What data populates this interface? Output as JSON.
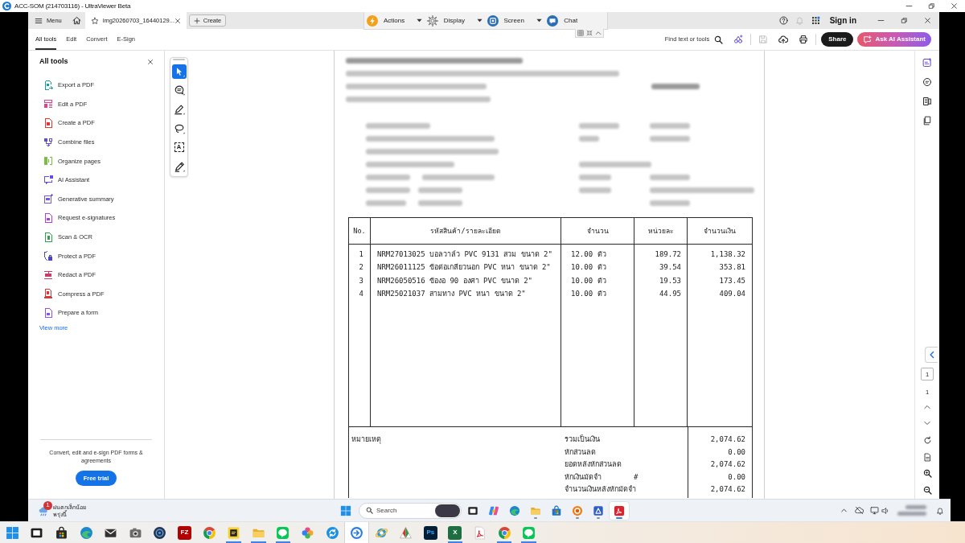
{
  "viewer_window": {
    "title": "ACC-SOM (214703116) - UltraViewer Beta"
  },
  "app_tabbar": {
    "menu_label": "Menu",
    "document_tab": {
      "label": "img20260703_16440129...",
      "selected": true
    },
    "create_label": "Create",
    "sign_in_label": "Sign in"
  },
  "viewer_toolbar": [
    {
      "kind": "actions",
      "label": "Actions",
      "dropdown": true
    },
    {
      "kind": "display",
      "label": "Display",
      "dropdown": true
    },
    {
      "kind": "screen",
      "label": "Screen",
      "dropdown": true
    },
    {
      "kind": "chat",
      "label": "Chat",
      "dropdown": false
    }
  ],
  "app_toolbar": {
    "tabs": [
      {
        "label": "All tools",
        "selected": true
      },
      {
        "label": "Edit",
        "selected": false
      },
      {
        "label": "Convert",
        "selected": false
      },
      {
        "label": "E-Sign",
        "selected": false
      }
    ],
    "find_label": "Find text or tools",
    "actions": [
      {
        "kind": "ai_tools",
        "disabled": false
      },
      {
        "kind": "save",
        "disabled": true
      },
      {
        "kind": "upload",
        "disabled": false
      },
      {
        "kind": "print",
        "disabled": false
      }
    ],
    "share_label": "Share",
    "ai_label": "Ask AI Assistant"
  },
  "tools_panel": {
    "title": "All tools",
    "items": [
      {
        "kind": "export",
        "label": "Export a PDF",
        "color": "#1d9a9f"
      },
      {
        "kind": "edit",
        "label": "Edit a PDF",
        "color": "#e0408c"
      },
      {
        "kind": "create",
        "label": "Create a PDF",
        "color": "#d83a3a"
      },
      {
        "kind": "combine",
        "label": "Combine files",
        "color": "#5a4fd4"
      },
      {
        "kind": "organize",
        "label": "Organize pages",
        "color": "#7cbf3f"
      },
      {
        "kind": "ai",
        "label": "AI Assistant",
        "color": "#6b48ee"
      },
      {
        "kind": "summary",
        "label": "Generative summary",
        "color": "#7756ef"
      },
      {
        "kind": "request_sign",
        "label": "Request e-signatures",
        "color": "#b13fcf"
      },
      {
        "kind": "scan",
        "label": "Scan & OCR",
        "color": "#34a04b"
      },
      {
        "kind": "protect",
        "label": "Protect a PDF",
        "color": "#4b46c7"
      },
      {
        "kind": "redact",
        "label": "Redact a PDF",
        "color": "#c83b6b"
      },
      {
        "kind": "compress",
        "label": "Compress a PDF",
        "color": "#d63b3b"
      },
      {
        "kind": "form",
        "label": "Prepare a form",
        "color": "#8957d8"
      }
    ],
    "more_link": "View more",
    "promo_text": "Convert, edit and e-sign PDF forms & agreements",
    "trial_button": "Free trial"
  },
  "quick_tools": [
    {
      "kind": "select",
      "selected": true
    },
    {
      "kind": "comment",
      "selected": false
    },
    {
      "kind": "draw",
      "selected": false
    },
    {
      "kind": "lasso",
      "selected": false
    },
    {
      "kind": "text_select",
      "glyph": "A",
      "selected": false
    },
    {
      "kind": "sign",
      "selected": false
    }
  ],
  "document": {
    "table": {
      "columns": [
        "No.",
        "รหัสสินค้า/รายละเอียด",
        "จำนวน",
        "หน่วยละ",
        "จำนวนเงิน"
      ],
      "rows": [
        {
          "no": "1",
          "item": "NRM27013025 บอลวาล์ว PVC 9131 สวม ขนาด 2\"",
          "quantity": "12.00 ตัว",
          "unit_price": "189.72",
          "amount": "1,138.32"
        },
        {
          "no": "2",
          "item": "NRM26011125 ข้อต่อเกลียวนอก PVC หนา ขนาด 2\"",
          "quantity": "10.00 ตัว",
          "unit_price": "39.54",
          "amount": "353.81"
        },
        {
          "no": "3",
          "item": "NRM26050516 ข้องอ 90 องศา PVC ขนาด 2\"",
          "quantity": "10.00 ตัว",
          "unit_price": "19.53",
          "amount": "173.45"
        },
        {
          "no": "4",
          "item": "NRM25021037 สามทาง PVC หนา ขนาด 2\"",
          "quantity": "10.00 ตัว",
          "unit_price": "44.95",
          "amount": "409.04"
        }
      ]
    },
    "summary": {
      "note_label": "หมายเหตุ",
      "lines": [
        {
          "label": "รวมเป็นเงิน",
          "value": "2,074.62"
        },
        {
          "label": "หักส่วนลด",
          "value": "0.00"
        },
        {
          "label": "ยอดหลังหักส่วนลด",
          "value": "2,074.62"
        },
        {
          "label": "หักเงินมัดจำ",
          "mark": "#",
          "value": "0.00"
        },
        {
          "label": "จำนวนเงินหลังหักมัดจำ",
          "value": "2,074.62"
        }
      ]
    }
  },
  "page_nav": {
    "current_page": "1",
    "page_count": "1"
  },
  "remote_taskbar": {
    "weather": {
      "badge": "1",
      "lines": [
        "ฝนตกเล็กน้อย",
        "พรุ่งนี้"
      ]
    },
    "search": {
      "placeholder": "Search"
    },
    "apps": [
      {
        "kind": "task_view",
        "running": false,
        "selected": false
      },
      {
        "kind": "copilot",
        "running": false,
        "selected": false
      },
      {
        "kind": "edge",
        "running": false,
        "selected": false
      },
      {
        "kind": "explorer",
        "running": true,
        "selected": false
      },
      {
        "kind": "store",
        "running": false,
        "selected": false
      },
      {
        "kind": "disc",
        "running": true,
        "selected": false
      },
      {
        "kind": "triangle_tile",
        "running": true,
        "selected": false
      },
      {
        "kind": "acrobat",
        "running": true,
        "selected": true
      }
    ]
  },
  "local_taskbar": {
    "apps": [
      {
        "kind": "start",
        "running": false,
        "selected": false
      },
      {
        "kind": "task_view",
        "running": false,
        "selected": false
      },
      {
        "kind": "store",
        "running": false,
        "selected": false
      },
      {
        "kind": "edge",
        "running": false,
        "selected": false
      },
      {
        "kind": "mail",
        "running": false,
        "selected": false
      },
      {
        "kind": "camera",
        "running": false,
        "selected": false
      },
      {
        "kind": "disc",
        "running": false,
        "selected": false
      },
      {
        "kind": "filezilla",
        "glyph": "FZ",
        "running": false,
        "selected": false
      },
      {
        "kind": "chrome",
        "running": false,
        "selected": false
      },
      {
        "kind": "sticky",
        "running": true,
        "selected": false
      },
      {
        "kind": "explorer",
        "running": true,
        "selected": false
      },
      {
        "kind": "line",
        "running": true,
        "selected": false
      },
      {
        "kind": "petals",
        "running": false,
        "selected": false
      },
      {
        "kind": "sync",
        "running": false,
        "selected": false
      },
      {
        "kind": "arrow_disc",
        "running": false,
        "selected": true
      },
      {
        "kind": "ie",
        "running": false,
        "selected": false
      },
      {
        "kind": "triangles",
        "running": false,
        "selected": false
      },
      {
        "kind": "photoshop",
        "glyph": "Ps",
        "running": false,
        "selected": false
      },
      {
        "kind": "excel",
        "glyph": "X",
        "running": true,
        "selected": false
      },
      {
        "kind": "acrobat",
        "running": false,
        "selected": false
      },
      {
        "kind": "chrome",
        "running": true,
        "selected": false
      },
      {
        "kind": "line",
        "running": true,
        "selected": false
      }
    ]
  }
}
